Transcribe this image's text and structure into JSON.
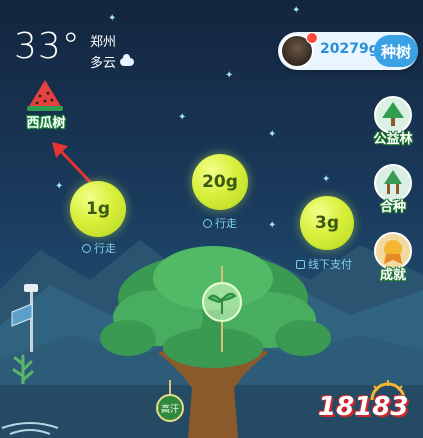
{
  "weather": {
    "temperature": "33°",
    "city": "郑州",
    "condition": "多云",
    "condition_icon": "cloud-icon"
  },
  "user": {
    "energy": "20279g",
    "plant_button": "种树"
  },
  "fruit_tree": {
    "label": "西瓜树"
  },
  "energy_bubbles": [
    {
      "amount": "1g",
      "source": "行走"
    },
    {
      "amount": "20g",
      "source": "行走"
    },
    {
      "amount": "3g",
      "source": "线下支付"
    }
  ],
  "side_menu": [
    {
      "label": "公益林",
      "icon": "forest-icon"
    },
    {
      "label": "合种",
      "icon": "co-plant-icon"
    },
    {
      "label": "成就",
      "icon": "achievement-icon"
    }
  ],
  "tree": {
    "tag": "高汗"
  },
  "watermark": "18183",
  "colors": {
    "bubble": "#d8f03c",
    "accent_blue": "#3aa1e5",
    "sky": "#1a3a5c"
  }
}
